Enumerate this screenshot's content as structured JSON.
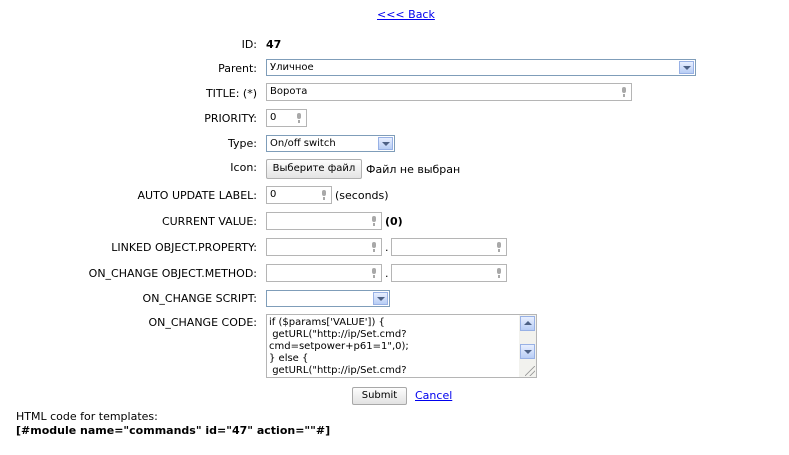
{
  "header": {
    "back_link": "<<< Back"
  },
  "form": {
    "id": {
      "label": "ID:",
      "value": "47"
    },
    "parent": {
      "label": "Parent:",
      "value": "Уличное"
    },
    "title": {
      "label": "TITLE: (*)",
      "value": "Ворота"
    },
    "priority": {
      "label": "PRIORITY:",
      "value": "0"
    },
    "type": {
      "label": "Type:",
      "value": "On/off switch"
    },
    "icon": {
      "label": "Icon:",
      "button": "Выберите файл",
      "status": "Файл не выбран"
    },
    "auto_update": {
      "label": "AUTO UPDATE LABEL:",
      "value": "0",
      "suffix": "(seconds)"
    },
    "current_value": {
      "label": "CURRENT VALUE:",
      "value": "",
      "suffix": "(0)"
    },
    "linked": {
      "label": "LINKED OBJECT.PROPERTY:",
      "object": "",
      "property": "",
      "separator": "."
    },
    "on_change_method": {
      "label": "ON_CHANGE OBJECT.METHOD:",
      "object": "",
      "method": "",
      "separator": "."
    },
    "on_change_script": {
      "label": "ON_CHANGE SCRIPT:",
      "value": ""
    },
    "on_change_code": {
      "label": "ON_CHANGE CODE:",
      "value": "if ($params['VALUE']) {\n getURL(\"http://ip/Set.cmd?cmd=setpower+p61=1\",0);\n} else {\n getURL(\"http://ip/Set.cmd?"
    },
    "submit": "Submit",
    "cancel": "Cancel"
  },
  "templates": {
    "label": "HTML code for templates:",
    "code": "[#module name=\"commands\" id=\"47\" action=\"\"#]"
  }
}
